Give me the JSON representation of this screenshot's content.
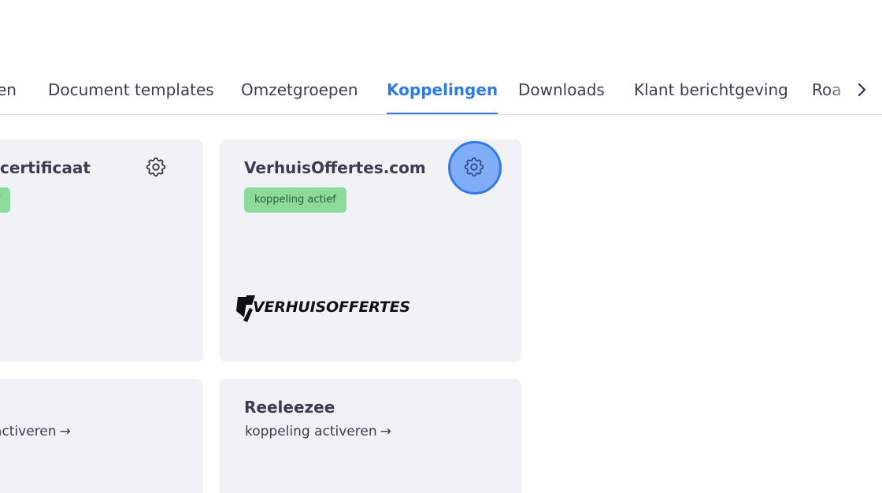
{
  "tabs": {
    "items": [
      {
        "label": "en"
      },
      {
        "label": "Document templates"
      },
      {
        "label": "Omzetgroepen"
      },
      {
        "label": "Koppelingen",
        "active": true
      },
      {
        "label": "Downloads"
      },
      {
        "label": "Klant berichtgeving"
      },
      {
        "label": "Roa"
      }
    ],
    "scroll_icon": "chevron-right-icon"
  },
  "cards": [
    {
      "title": "certificaat",
      "badge": "ief",
      "icon": "gear-icon"
    },
    {
      "title": "VerhuisOffertes.com",
      "badge": "koppeling actief",
      "icon": "gear-icon",
      "logo_text": "VERHUISOFFERTES"
    },
    {
      "link": "activeren",
      "link_arrow": "→"
    },
    {
      "title": "Reeleezee",
      "link": "koppeling activeren",
      "link_arrow": "→"
    }
  ],
  "colors": {
    "accent": "#2f7be6",
    "card_bg": "#f1f2f6",
    "badge_bg": "#8cdb9a",
    "badge_text": "#24613a"
  }
}
